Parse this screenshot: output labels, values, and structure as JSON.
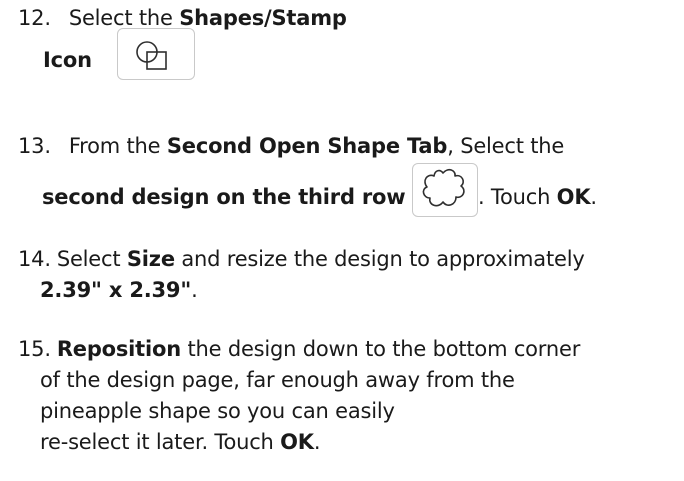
{
  "steps": [
    {
      "number": "12.",
      "text_before": "Select the ",
      "bold_1": "Shapes/Stamp",
      "bold_2": "Icon",
      "text_after": ".",
      "icon": "shapes-stamp-icon"
    },
    {
      "number": "13.",
      "text_before": "From the ",
      "bold_1": "Second Open Shape Tab",
      "text_mid": ", Select the",
      "bold_2": "second design on the third row",
      "text_mid_2": ". Touch ",
      "bold_3": "OK",
      "text_after": ".",
      "icon": "cloud-shape-icon"
    },
    {
      "number": "14.",
      "text_before": "Select ",
      "bold_1": "Size",
      "text_mid": " and resize the design to approximately",
      "bold_2": "2.39\" x 2.39\"",
      "text_after": "."
    },
    {
      "number": "15.",
      "bold_1": "Reposition",
      "line_1_rest": " the design down to the bottom corner",
      "line_2": "of the design page, far enough away from the",
      "line_3": "pineapple shape so you can easily",
      "line_4_before": "re-select it later. Touch ",
      "bold_2": "OK",
      "text_after": "."
    }
  ],
  "colors": {
    "text": "#1a1a1a",
    "icon_border": "#c9c9c9",
    "icon_stroke": "#2f2f2f"
  }
}
